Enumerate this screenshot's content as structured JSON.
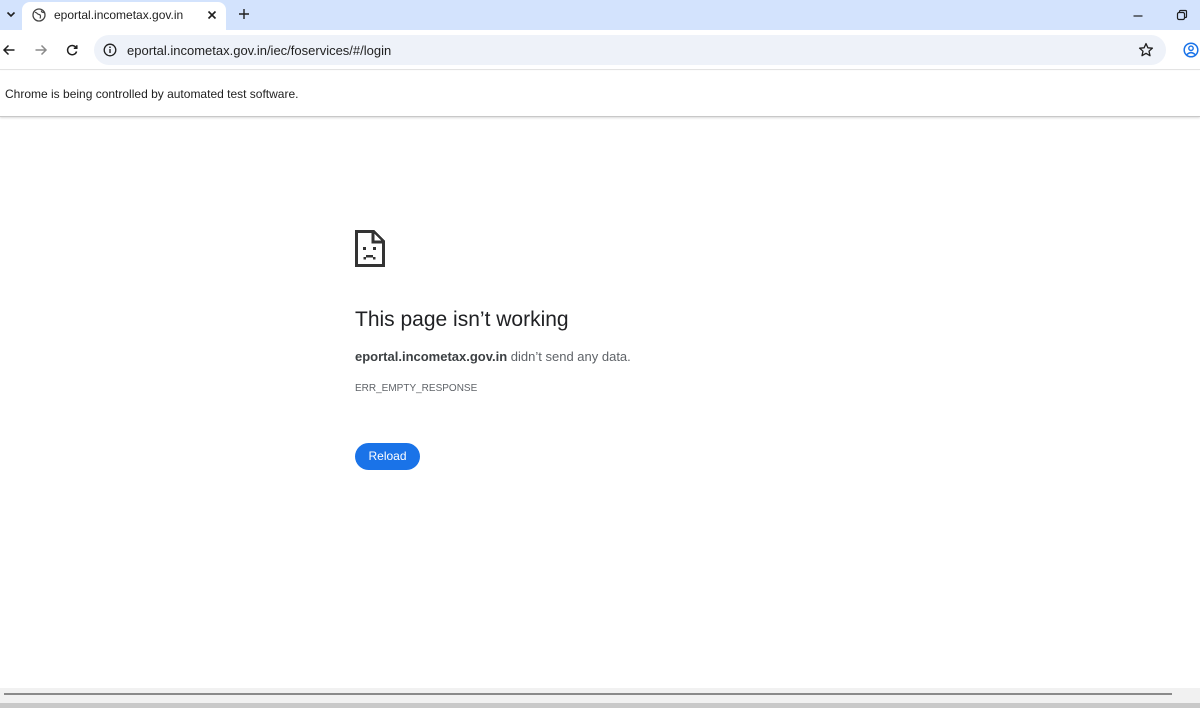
{
  "browser": {
    "tab": {
      "title": "eportal.incometax.gov.in",
      "favicon": "globe-icon"
    },
    "omnibox": {
      "url": "eportal.incometax.gov.in/iec/foservices/#/login"
    },
    "infobar": {
      "text": "Chrome is being controlled by automated test software."
    },
    "icons": {
      "tab_search": "chevron-down-icon",
      "tab_close": "close-icon",
      "new_tab": "plus-icon",
      "minimize": "minimize-icon",
      "restore": "restore-icon",
      "back": "back-arrow-icon",
      "forward": "forward-arrow-icon",
      "reload": "reload-icon",
      "site_info": "info-icon",
      "bookmark": "star-icon",
      "profile": "profile-icon"
    }
  },
  "error_page": {
    "icon": "sad-page-icon",
    "title": "This page isn’t working",
    "host": "eportal.incometax.gov.in",
    "message": " didn’t send any data.",
    "code": "ERR_EMPTY_RESPONSE",
    "reload_label": "Reload"
  },
  "colors": {
    "tabstrip": "#d3e3fd",
    "omnibox": "#eef2f9",
    "button": "#1a73e8"
  }
}
